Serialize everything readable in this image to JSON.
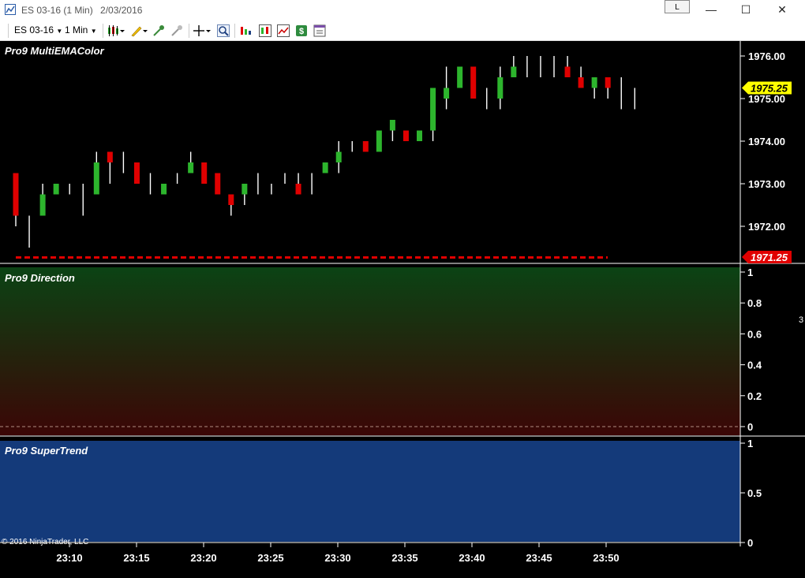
{
  "window": {
    "title": "ES 03-16 (1 Min)",
    "date": "2/03/2016",
    "link_button": "L",
    "minimize_glyph": "—",
    "maximize_glyph": "☐",
    "close_glyph": "✕"
  },
  "toolbar": {
    "instrument": "ES 03-16",
    "interval": "1 Min",
    "icons": [
      "bar-type-icon",
      "drawing-tools-icon",
      "attach-order-icon",
      "hide-drawings-icon",
      "crosshair-icon",
      "zoom-icon",
      "indicators-icon",
      "strategies-icon",
      "chart-style-icon",
      "data-box-icon",
      "properties-icon"
    ]
  },
  "panels": {
    "price": {
      "title": "Pro9 MultiEMAColor",
      "last_price": "1975.25",
      "stop_level": "1971.25",
      "y_ticks": [
        "1976.00",
        "1975.00",
        "1974.00",
        "1973.00",
        "1972.00"
      ]
    },
    "direction": {
      "title": "Pro9 Direction",
      "y_ticks": [
        "1",
        "0.8",
        "0.6",
        "0.4",
        "0.2",
        "0"
      ]
    },
    "supertrend": {
      "title": "Pro9 SuperTrend",
      "y_ticks": [
        "1",
        "0.5",
        "0"
      ]
    }
  },
  "x_axis": {
    "labels": [
      "23:10",
      "23:15",
      "23:20",
      "23:25",
      "23:30",
      "23:35",
      "23:40",
      "23:45",
      "23:50"
    ]
  },
  "copyright": "© 2016 NinjaTrader, LLC",
  "right_edge_char": "3",
  "colors": {
    "up": "#2db52d",
    "down": "#e00000",
    "neutral": "#ffffff",
    "last_price_bg": "#ffff00",
    "stop_bg": "#e00000",
    "direction_top": "#0b4314",
    "direction_bottom": "#3b0606",
    "supertrend_bg": "#143a7a"
  },
  "chart_data": {
    "type": "candlestick",
    "y_unit": "price",
    "ylim": [
      1971.4,
      1976.3
    ],
    "stop_line": 1971.25,
    "candles": [
      {
        "o": 1973.25,
        "h": 1973.25,
        "l": 1972.0,
        "c": 1972.25,
        "color": "down"
      },
      {
        "o": 1972.25,
        "h": 1972.25,
        "l": 1971.5,
        "c": 1972.25,
        "color": "neutral"
      },
      {
        "o": 1972.25,
        "h": 1973.0,
        "l": 1972.25,
        "c": 1972.75,
        "color": "up"
      },
      {
        "o": 1972.75,
        "h": 1973.0,
        "l": 1972.75,
        "c": 1973.0,
        "color": "up"
      },
      {
        "o": 1973.0,
        "h": 1973.0,
        "l": 1972.75,
        "c": 1973.0,
        "color": "neutral"
      },
      {
        "o": 1973.0,
        "h": 1973.0,
        "l": 1972.25,
        "c": 1972.75,
        "color": "neutral"
      },
      {
        "o": 1972.75,
        "h": 1973.75,
        "l": 1972.75,
        "c": 1973.5,
        "color": "up"
      },
      {
        "o": 1973.75,
        "h": 1973.75,
        "l": 1973.0,
        "c": 1973.5,
        "color": "down"
      },
      {
        "o": 1973.5,
        "h": 1973.75,
        "l": 1973.25,
        "c": 1973.5,
        "color": "neutral"
      },
      {
        "o": 1973.5,
        "h": 1973.5,
        "l": 1973.0,
        "c": 1973.0,
        "color": "down"
      },
      {
        "o": 1973.25,
        "h": 1973.25,
        "l": 1972.75,
        "c": 1973.25,
        "color": "neutral"
      },
      {
        "o": 1972.75,
        "h": 1973.0,
        "l": 1972.75,
        "c": 1973.0,
        "color": "up"
      },
      {
        "o": 1973.25,
        "h": 1973.25,
        "l": 1973.0,
        "c": 1973.25,
        "color": "neutral"
      },
      {
        "o": 1973.25,
        "h": 1973.75,
        "l": 1973.25,
        "c": 1973.5,
        "color": "up"
      },
      {
        "o": 1973.5,
        "h": 1973.5,
        "l": 1973.0,
        "c": 1973.0,
        "color": "down"
      },
      {
        "o": 1973.25,
        "h": 1973.25,
        "l": 1972.75,
        "c": 1972.75,
        "color": "down"
      },
      {
        "o": 1972.75,
        "h": 1972.75,
        "l": 1972.25,
        "c": 1972.5,
        "color": "down"
      },
      {
        "o": 1972.75,
        "h": 1973.0,
        "l": 1972.5,
        "c": 1973.0,
        "color": "up"
      },
      {
        "o": 1973.0,
        "h": 1973.25,
        "l": 1972.75,
        "c": 1973.0,
        "color": "neutral"
      },
      {
        "o": 1973.0,
        "h": 1973.0,
        "l": 1972.75,
        "c": 1973.0,
        "color": "neutral"
      },
      {
        "o": 1973.0,
        "h": 1973.25,
        "l": 1973.0,
        "c": 1973.0,
        "color": "neutral"
      },
      {
        "o": 1973.0,
        "h": 1973.25,
        "l": 1972.75,
        "c": 1972.75,
        "color": "down"
      },
      {
        "o": 1972.75,
        "h": 1973.25,
        "l": 1972.75,
        "c": 1973.25,
        "color": "neutral"
      },
      {
        "o": 1973.25,
        "h": 1973.5,
        "l": 1973.25,
        "c": 1973.5,
        "color": "up"
      },
      {
        "o": 1973.5,
        "h": 1974.0,
        "l": 1973.25,
        "c": 1973.75,
        "color": "up"
      },
      {
        "o": 1974.0,
        "h": 1974.0,
        "l": 1973.75,
        "c": 1974.0,
        "color": "neutral"
      },
      {
        "o": 1974.0,
        "h": 1974.0,
        "l": 1973.75,
        "c": 1973.75,
        "color": "down"
      },
      {
        "o": 1973.75,
        "h": 1974.25,
        "l": 1973.75,
        "c": 1974.25,
        "color": "up"
      },
      {
        "o": 1974.25,
        "h": 1974.5,
        "l": 1974.0,
        "c": 1974.5,
        "color": "up"
      },
      {
        "o": 1974.25,
        "h": 1974.25,
        "l": 1974.0,
        "c": 1974.0,
        "color": "down"
      },
      {
        "o": 1974.0,
        "h": 1974.25,
        "l": 1974.0,
        "c": 1974.25,
        "color": "up"
      },
      {
        "o": 1974.25,
        "h": 1975.25,
        "l": 1974.0,
        "c": 1975.25,
        "color": "up"
      },
      {
        "o": 1975.0,
        "h": 1975.75,
        "l": 1974.75,
        "c": 1975.25,
        "color": "up"
      },
      {
        "o": 1975.25,
        "h": 1975.75,
        "l": 1975.25,
        "c": 1975.75,
        "color": "up"
      },
      {
        "o": 1975.75,
        "h": 1975.75,
        "l": 1975.0,
        "c": 1975.0,
        "color": "down"
      },
      {
        "o": 1975.25,
        "h": 1975.25,
        "l": 1974.75,
        "c": 1975.25,
        "color": "neutral"
      },
      {
        "o": 1975.0,
        "h": 1975.75,
        "l": 1974.75,
        "c": 1975.5,
        "color": "up"
      },
      {
        "o": 1975.5,
        "h": 1976.0,
        "l": 1975.5,
        "c": 1975.75,
        "color": "up"
      },
      {
        "o": 1975.75,
        "h": 1976.0,
        "l": 1975.5,
        "c": 1975.75,
        "color": "neutral"
      },
      {
        "o": 1975.75,
        "h": 1976.0,
        "l": 1975.5,
        "c": 1975.75,
        "color": "neutral"
      },
      {
        "o": 1975.75,
        "h": 1976.0,
        "l": 1975.5,
        "c": 1975.75,
        "color": "neutral"
      },
      {
        "o": 1975.75,
        "h": 1976.0,
        "l": 1975.5,
        "c": 1975.5,
        "color": "down"
      },
      {
        "o": 1975.5,
        "h": 1975.75,
        "l": 1975.25,
        "c": 1975.25,
        "color": "down"
      },
      {
        "o": 1975.25,
        "h": 1975.5,
        "l": 1975.0,
        "c": 1975.5,
        "color": "up"
      },
      {
        "o": 1975.5,
        "h": 1975.5,
        "l": 1975.0,
        "c": 1975.25,
        "color": "down"
      },
      {
        "o": 1975.25,
        "h": 1975.5,
        "l": 1974.75,
        "c": 1975.25,
        "color": "neutral"
      },
      {
        "o": 1975.0,
        "h": 1975.25,
        "l": 1974.75,
        "c": 1975.0,
        "color": "neutral"
      }
    ]
  }
}
